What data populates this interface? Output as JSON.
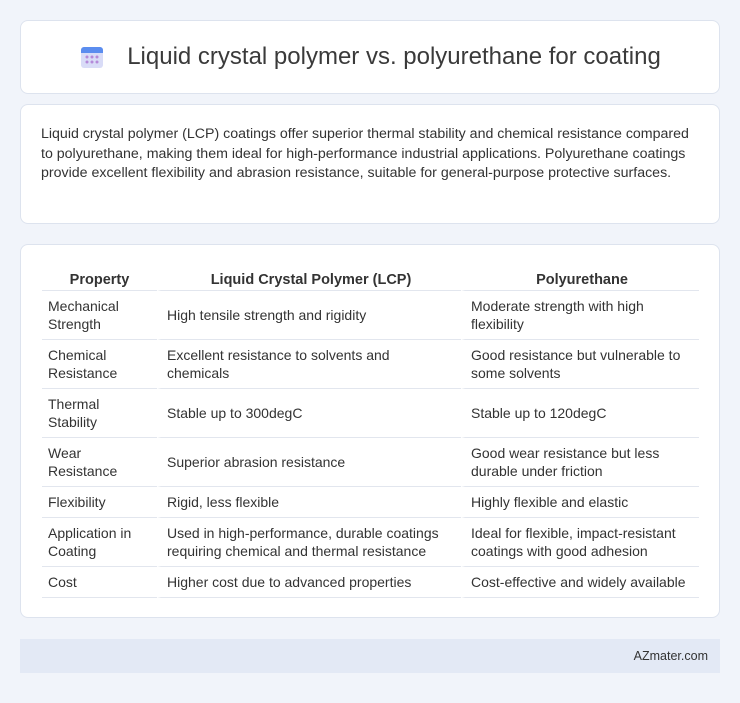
{
  "header": {
    "icon": "calendar-icon",
    "title": "Liquid crystal polymer vs. polyurethane for coating"
  },
  "intro": {
    "text": "Liquid crystal polymer (LCP) coatings offer superior thermal stability and chemical resistance compared to polyurethane, making them ideal for high-performance industrial applications. Polyurethane coatings provide excellent flexibility and abrasion resistance, suitable for general-purpose protective surfaces."
  },
  "table": {
    "headers": [
      "Property",
      "Liquid Crystal Polymer (LCP)",
      "Polyurethane"
    ],
    "rows": [
      [
        "Mechanical Strength",
        "High tensile strength and rigidity",
        "Moderate strength with high flexibility"
      ],
      [
        "Chemical Resistance",
        "Excellent resistance to solvents and chemicals",
        "Good resistance but vulnerable to some solvents"
      ],
      [
        "Thermal Stability",
        "Stable up to 300degC",
        "Stable up to 120degC"
      ],
      [
        "Wear Resistance",
        "Superior abrasion resistance",
        "Good wear resistance but less durable under friction"
      ],
      [
        "Flexibility",
        "Rigid, less flexible",
        "Highly flexible and elastic"
      ],
      [
        "Application in Coating",
        "Used in high-performance, durable coatings requiring chemical and thermal resistance",
        "Ideal for flexible, impact-resistant coatings with good adhesion"
      ],
      [
        "Cost",
        "Higher cost due to advanced properties",
        "Cost-effective and widely available"
      ]
    ]
  },
  "footer": {
    "brand": "AZmater.com"
  }
}
